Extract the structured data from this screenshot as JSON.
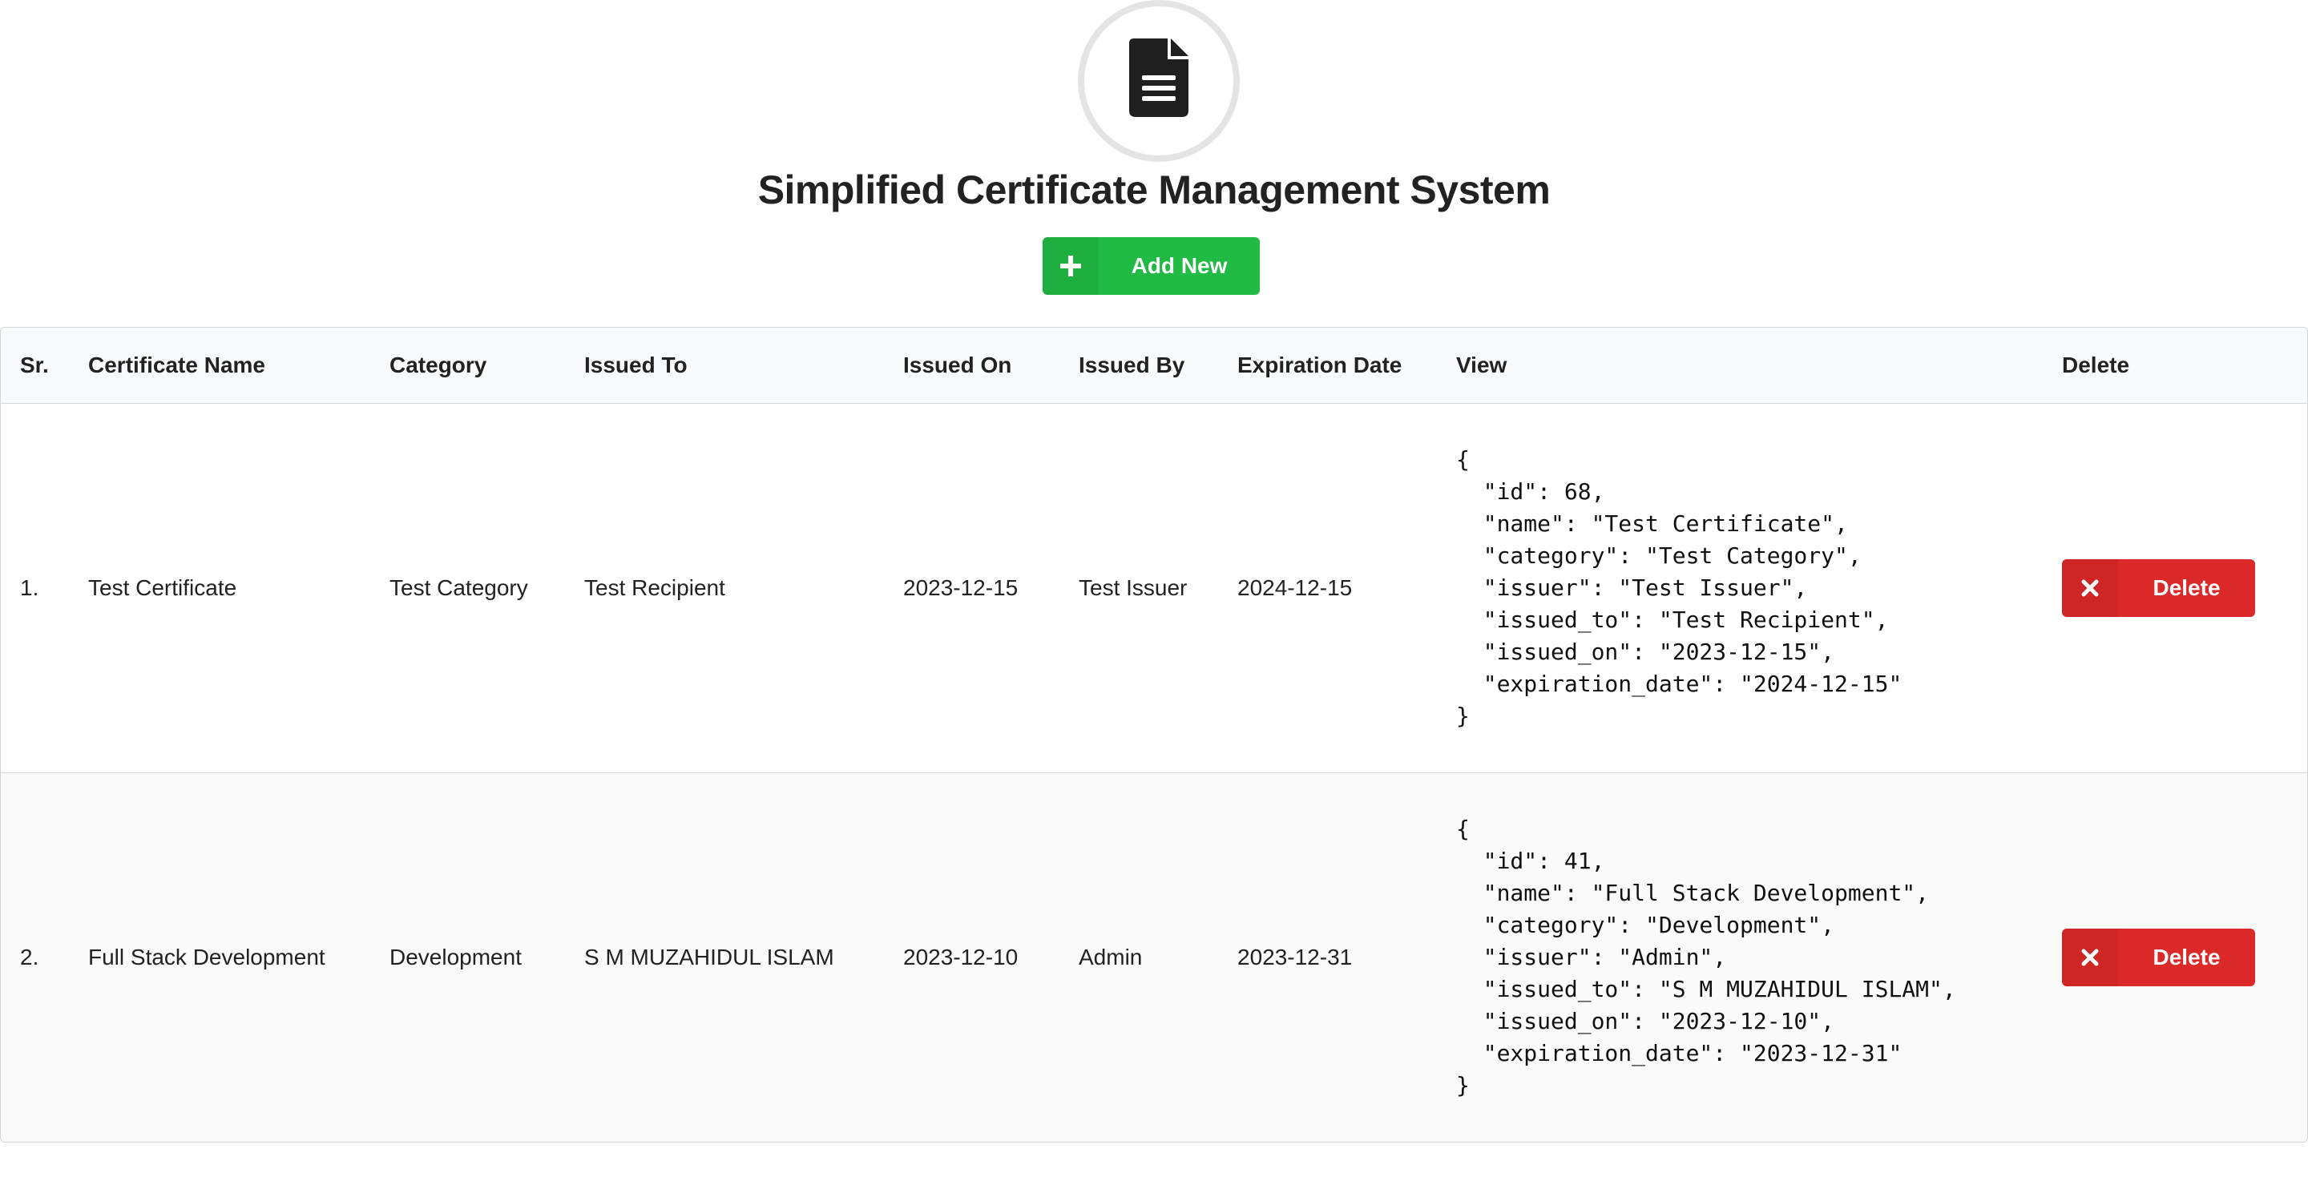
{
  "header": {
    "logo_icon": "file-text-icon",
    "title": "Simplified Certificate Management System",
    "add_button": {
      "label": "Add New",
      "icon": "plus-icon",
      "color": "#21ba45"
    }
  },
  "table": {
    "columns": [
      "Sr.",
      "Certificate Name",
      "Category",
      "Issued To",
      "Issued On",
      "Issued By",
      "Expiration Date",
      "View",
      "Delete"
    ],
    "rows": [
      {
        "sr": "1.",
        "name": "Test Certificate",
        "category": "Test Category",
        "issued_to": "Test Recipient",
        "issued_on": "2023-12-15",
        "issued_by": "Test Issuer",
        "expiration_date": "2024-12-15",
        "view_json": "{\n  \"id\": 68,\n  \"name\": \"Test Certificate\",\n  \"category\": \"Test Category\",\n  \"issuer\": \"Test Issuer\",\n  \"issued_to\": \"Test Recipient\",\n  \"issued_on\": \"2023-12-15\",\n  \"expiration_date\": \"2024-12-15\"\n}",
        "delete_label": "Delete"
      },
      {
        "sr": "2.",
        "name": "Full Stack Development",
        "category": "Development",
        "issued_to": "S M MUZAHIDUL ISLAM",
        "issued_on": "2023-12-10",
        "issued_by": "Admin",
        "expiration_date": "2023-12-31",
        "view_json": "{\n  \"id\": 41,\n  \"name\": \"Full Stack Development\",\n  \"category\": \"Development\",\n  \"issuer\": \"Admin\",\n  \"issued_to\": \"S M MUZAHIDUL ISLAM\",\n  \"issued_on\": \"2023-12-10\",\n  \"expiration_date\": \"2023-12-31\"\n}",
        "delete_label": "Delete"
      }
    ],
    "delete_icon": "close-icon",
    "delete_color": "#db2828"
  }
}
